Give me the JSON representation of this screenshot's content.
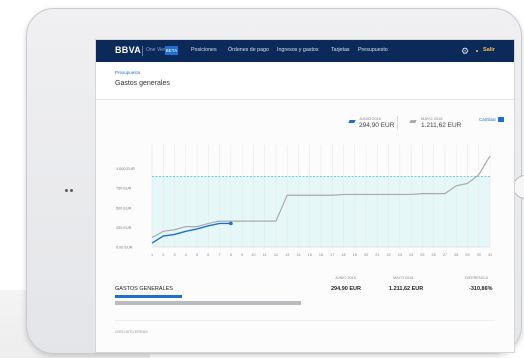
{
  "nav": {
    "logo": "BBVA",
    "subtitle": "One View",
    "badge": "BETA",
    "items": [
      "Posiciones",
      "Órdenes de pago",
      "Ingresos y gastos",
      "Tarjetas",
      "Presupuesto"
    ],
    "exit": "Salir"
  },
  "breadcrumb": "Presupuesto",
  "page_title": "Gastos generales",
  "legend": {
    "a_label": "JUNIO 2016",
    "a_value": "294,90 EUR",
    "b_label": "MAYO 2016",
    "b_value": "1.211,62 EUR",
    "compare": "Cambiar"
  },
  "colors": {
    "navy": "#0b2a5a",
    "blue": "#1f6fd1",
    "gray_series": "#a9abaf",
    "budget_line": "#49c2c9",
    "budget_fill": "#e6f7f8",
    "exit_accent": "#f6c445"
  },
  "chart_data": {
    "type": "line",
    "ylabel": "",
    "xlabel": "",
    "ylim": [
      0,
      1300
    ],
    "yticks": [
      0,
      250,
      500,
      750,
      1000
    ],
    "ytick_labels": [
      "0,00 EUR",
      "250 EUR",
      "500 EUR",
      "750 EUR",
      "1.000 EUR"
    ],
    "x": [
      1,
      2,
      3,
      4,
      5,
      6,
      7,
      8,
      9,
      10,
      11,
      12,
      13,
      14,
      15,
      16,
      17,
      18,
      19,
      20,
      21,
      22,
      23,
      24,
      25,
      26,
      27,
      28,
      29,
      30,
      31
    ],
    "budget": 900,
    "series": [
      {
        "values": [
          120,
          200,
          220,
          260,
          260,
          300,
          330,
          330,
          330,
          330,
          330,
          330,
          660,
          660,
          660,
          660,
          660,
          670,
          670,
          670,
          670,
          670,
          670,
          670,
          680,
          680,
          680,
          780,
          810,
          920,
          1160
        ]
      },
      {
        "values": [
          50,
          140,
          160,
          200,
          230,
          270,
          300,
          300
        ]
      }
    ]
  },
  "table": {
    "col_a": "JUNIO 2016",
    "col_b": "MAYO 2016",
    "col_c": "DIFERENCIA",
    "row_label": "GASTOS GENERALES",
    "row_a": "294,90 EUR",
    "row_b": "1.211,62 EUR",
    "row_c": "-310,86%"
  },
  "footer": "GIRO ATELERRAS"
}
